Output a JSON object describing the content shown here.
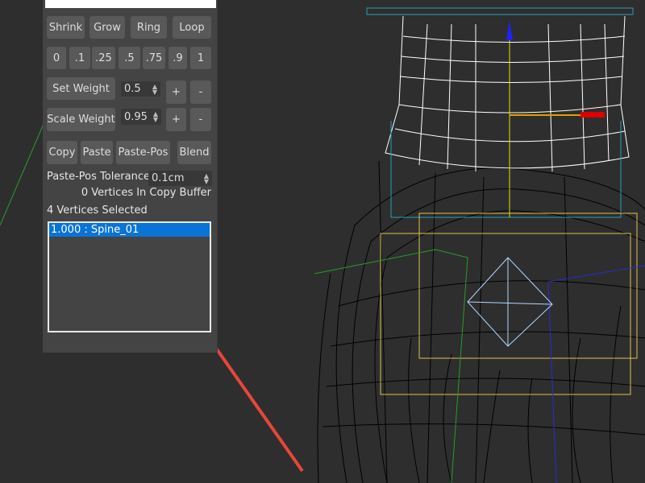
{
  "panel": {
    "select_buttons": [
      "Shrink",
      "Grow",
      "Ring",
      "Loop"
    ],
    "weight_presets": [
      "0",
      ".1",
      ".25",
      ".5",
      ".75",
      ".9",
      "1"
    ],
    "set_weight": {
      "label": "Set Weight",
      "value": "0.5",
      "plus": "+",
      "minus": "-"
    },
    "scale_weight": {
      "label": "Scale Weight",
      "value": "0.95",
      "plus": "+",
      "minus": "-"
    },
    "clipboard_buttons": [
      "Copy",
      "Paste",
      "Paste-Pos",
      "Blend"
    ],
    "tolerance": {
      "label": "Paste-Pos Tolerance",
      "value": "0.1cm"
    },
    "copy_buffer": "0 Vertices In Copy Buffer",
    "selected_count": "4 Vertices Selected",
    "weight_list": [
      "1.000 : Spine_01"
    ]
  },
  "colors": {
    "viewport_bg": "#2e2e2e",
    "panel_bg": "#444444",
    "selection": "#0a74d6",
    "annotation_arrow": "#e8463c"
  }
}
